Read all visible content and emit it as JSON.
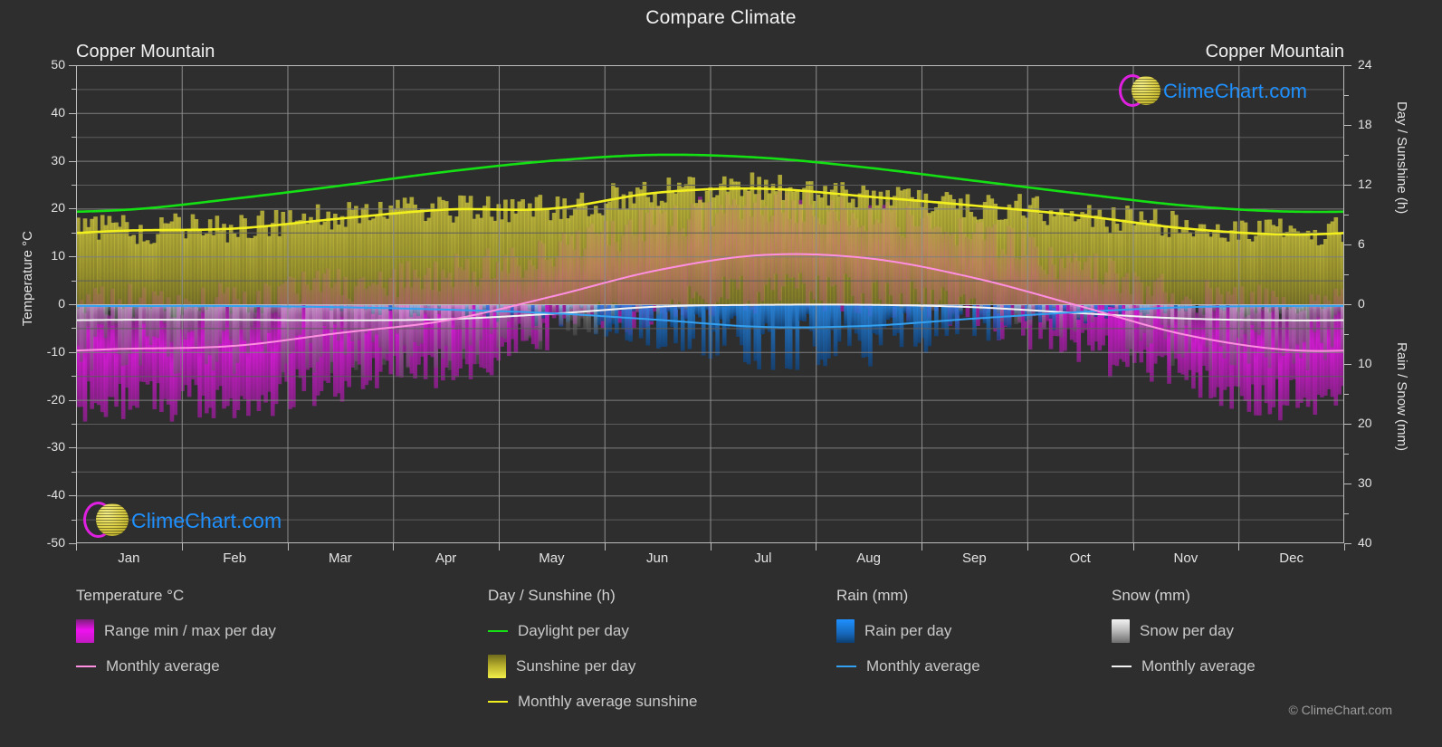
{
  "header": {
    "main_title": "Compare Climate",
    "left_station": "Copper Mountain",
    "right_station": "Copper Mountain"
  },
  "axes": {
    "y_left_title": "Temperature °C",
    "y_right_top_title": "Day / Sunshine (h)",
    "y_right_bottom_title": "Rain / Snow (mm)",
    "y_left_ticks": [
      "50",
      "40",
      "30",
      "20",
      "10",
      "0",
      "-10",
      "-20",
      "-30",
      "-40",
      "-50"
    ],
    "y_right_ticks": [
      "24",
      "18",
      "12",
      "6",
      "0",
      "10",
      "20",
      "30",
      "40"
    ],
    "x_ticks": [
      "Jan",
      "Feb",
      "Mar",
      "Apr",
      "May",
      "Jun",
      "Jul",
      "Aug",
      "Sep",
      "Oct",
      "Nov",
      "Dec"
    ]
  },
  "watermark": {
    "text": "ClimeChart.com"
  },
  "legend": {
    "columns": [
      {
        "title": "Temperature °C",
        "items": [
          {
            "label": "Range min / max per day",
            "marker": "swatch",
            "color": "#ef12ef"
          },
          {
            "label": "Monthly average",
            "marker": "line",
            "color": "#ff8fe0"
          }
        ]
      },
      {
        "title": "Day / Sunshine (h)",
        "items": [
          {
            "label": "Daylight per day",
            "marker": "line",
            "color": "#14e014"
          },
          {
            "label": "Sunshine per day",
            "marker": "swatch",
            "color": "#f2ef4a"
          },
          {
            "label": "Monthly average sunshine",
            "marker": "line",
            "color": "#f2ef1e"
          }
        ]
      },
      {
        "title": "Rain (mm)",
        "items": [
          {
            "label": "Rain per day",
            "marker": "swatch",
            "color": "#1e90ff"
          },
          {
            "label": "Monthly average",
            "marker": "line",
            "color": "#33a0f0"
          }
        ]
      },
      {
        "title": "Snow (mm)",
        "items": [
          {
            "label": "Snow per day",
            "marker": "swatch",
            "color": "#e6e6e6"
          },
          {
            "label": "Monthly average",
            "marker": "line",
            "color": "#f2f2f2"
          }
        ]
      }
    ],
    "copyright": "© ClimeChart.com"
  },
  "colors": {
    "background": "#2e2e2e",
    "grid": "#8d8d8d",
    "axis": "#bdbdbd",
    "text": "#e3e3e3",
    "daylight": "#14e014",
    "sunshine_line": "#f2ef1e",
    "sunshine_fill": "#b5ad2c",
    "temp_range": "#ef12ef",
    "temp_avg": "#ff8fe0",
    "rain_fill": "#1565a8",
    "rain_line": "#33a0f0",
    "snow_fill": "#8a8a8a",
    "snow_line": "#f2f2f2",
    "logo_blue": "#1e90ff",
    "logo_magenta": "#e020e0",
    "logo_yellow": "#ded24a"
  },
  "chart_data": {
    "type": "area",
    "title": "Compare Climate",
    "subtitle": "Copper Mountain",
    "xlabel": "",
    "ylabel": "Temperature °C",
    "ylabel_right_top": "Day / Sunshine (h)",
    "ylabel_right_bottom": "Rain / Snow (mm)",
    "grid": true,
    "legend_position": "bottom",
    "categories": [
      "Jan",
      "Feb",
      "Mar",
      "Apr",
      "May",
      "Jun",
      "Jul",
      "Aug",
      "Sep",
      "Oct",
      "Nov",
      "Dec"
    ],
    "ylim": [
      -50,
      50
    ],
    "ylim_right_top": [
      0,
      24
    ],
    "ylim_right_bottom": [
      0,
      40
    ],
    "series": [
      {
        "name": "Daylight per day",
        "unit": "h",
        "axis": "right-top",
        "color": "#14e014",
        "values": [
          9.5,
          10.6,
          11.9,
          13.3,
          14.4,
          15.0,
          14.7,
          13.7,
          12.4,
          11.1,
          9.9,
          9.3
        ]
      },
      {
        "name": "Monthly average sunshine",
        "unit": "h",
        "axis": "right-top",
        "color": "#f2ef1e",
        "values": [
          7.4,
          7.6,
          8.6,
          9.5,
          9.6,
          11.2,
          11.6,
          10.8,
          9.9,
          8.9,
          7.6,
          7.0
        ]
      },
      {
        "name": "Monthly average temperature",
        "unit": "°C",
        "axis": "left",
        "color": "#ff8fe0",
        "values": [
          -9.3,
          -8.7,
          -6.0,
          -3.4,
          1.6,
          7.1,
          10.3,
          9.6,
          5.5,
          -0.4,
          -6.4,
          -9.6
        ]
      },
      {
        "name": "Range min / max per day",
        "unit": "°C",
        "axis": "left",
        "color": "#ef12ef",
        "min": [
          -19.5,
          -19.0,
          -16.0,
          -12.0,
          -6.0,
          -0.5,
          3.0,
          2.5,
          -2.0,
          -8.0,
          -15.0,
          -19.5
        ],
        "max": [
          0.5,
          1.5,
          4.0,
          6.5,
          11.0,
          17.0,
          20.0,
          19.0,
          14.5,
          7.5,
          2.0,
          0.0
        ]
      },
      {
        "name": "Rain monthly average",
        "unit": "mm",
        "axis": "right-bottom",
        "color": "#33a0f0",
        "values": [
          0.3,
          0.3,
          0.5,
          0.9,
          1.5,
          2.6,
          3.8,
          3.6,
          2.4,
          1.3,
          0.5,
          0.3
        ]
      },
      {
        "name": "Snow monthly average",
        "unit": "mm",
        "axis": "right-bottom",
        "color": "#f2f2f2",
        "values": [
          2.6,
          2.6,
          2.7,
          2.5,
          1.6,
          0.4,
          0.1,
          0.1,
          0.5,
          1.5,
          2.4,
          2.7
        ]
      }
    ]
  }
}
